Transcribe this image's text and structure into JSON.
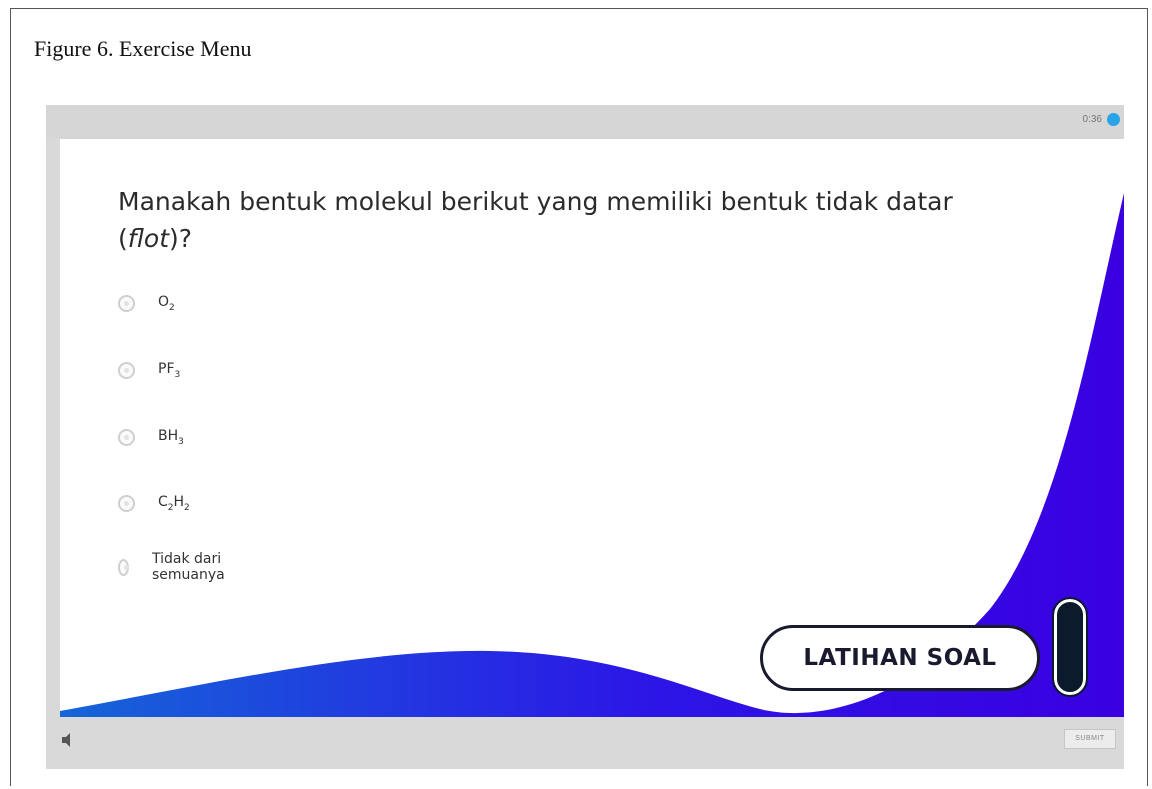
{
  "caption": "Figure 6. Exercise Menu",
  "player": {
    "timer": "0:36"
  },
  "quiz": {
    "question_main": "Manakah bentuk molekul berikut yang memiliki bentuk tidak datar (",
    "question_italic": "flot",
    "question_end": ")?",
    "options": [
      {
        "label": "O",
        "sub": "2"
      },
      {
        "label": "PF",
        "sub": "3"
      },
      {
        "label": "BH",
        "sub": "3"
      },
      {
        "label": "C",
        "sub": "2",
        "label2": "H",
        "sub2": "2"
      },
      {
        "label": "Tidak dari semuanya"
      }
    ]
  },
  "badge": "LATIHAN SOAL",
  "footer": {
    "submit_label": "SUBMIT"
  },
  "icons": {
    "timer_dot": "info-dot-icon",
    "speaker": "speaker-icon"
  },
  "colors": {
    "wave_dark": "#3a00e0",
    "wave_light": "#1565d8",
    "timer_dot": "#2aa3e8"
  }
}
